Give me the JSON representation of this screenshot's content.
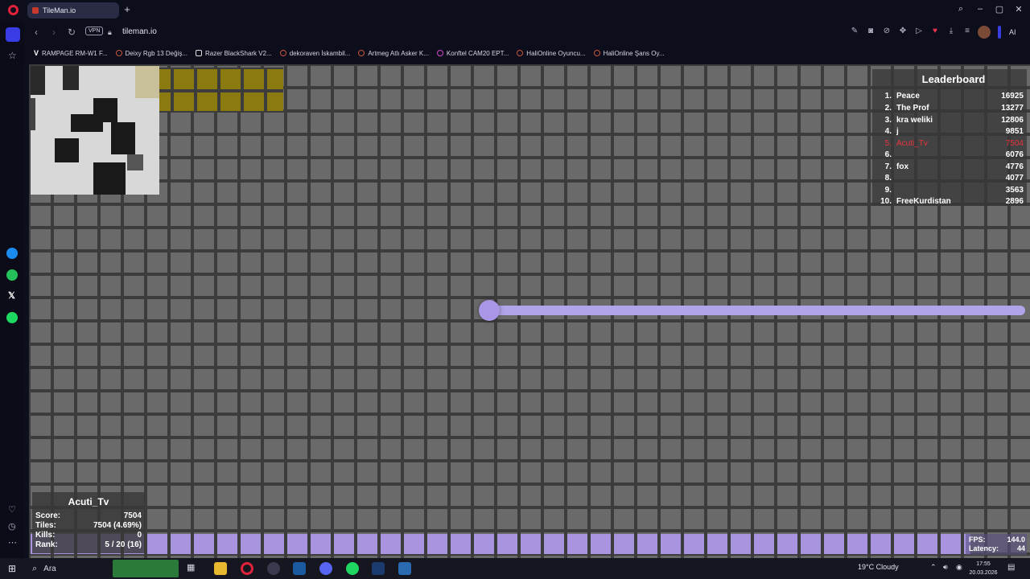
{
  "browser": {
    "tab_title": "TileMan.io",
    "url": "tileman.io",
    "vpn_label": "VPN",
    "ai_label": "AI",
    "bookmarks": [
      "RAMPAGE RM-W1 F...",
      "Deixy Rgb 13 Değiş...",
      "Razer BlackShark V2...",
      "dekoraven İskambil...",
      "Artmeg Atlı Asker K...",
      "Konftel CAM20 EPT...",
      "HaliOnline Oyuncu...",
      "HaliOnline Şans Oy..."
    ]
  },
  "leaderboard": {
    "title": "Leaderboard",
    "rows": [
      {
        "rank": "1.",
        "name": "Peace",
        "score": "16925"
      },
      {
        "rank": "2.",
        "name": "The Prof",
        "score": "13277"
      },
      {
        "rank": "3.",
        "name": "kra weliki",
        "score": "12806"
      },
      {
        "rank": "4.",
        "name": "j",
        "score": "9851"
      },
      {
        "rank": "5.",
        "name": "Acuti_Tv",
        "score": "7504"
      },
      {
        "rank": "6.",
        "name": "",
        "score": "6076"
      },
      {
        "rank": "7.",
        "name": "fox",
        "score": "4776"
      },
      {
        "rank": "8.",
        "name": "",
        "score": "4077"
      },
      {
        "rank": "9.",
        "name": "",
        "score": "3563"
      },
      {
        "rank": "10.",
        "name": "FreeKurdistan",
        "score": "2896"
      }
    ],
    "highlight_color": "#e8343c"
  },
  "player": {
    "name": "Acuti_Tv",
    "score_label": "Score:",
    "score": "7504",
    "tiles_label": "Tiles:",
    "tiles": "7504 (4.69%)",
    "kills_label": "Kills:",
    "kills": "0",
    "rank_label": "Rank:",
    "rank": "5 / 20 (16)",
    "color": "#a996e6"
  },
  "perf": {
    "fps_label": "FPS:",
    "fps": "144.0",
    "latency_label": "Latency:",
    "latency": "44"
  },
  "taskbar": {
    "search_label": "Ara",
    "weather": "19°C  Cloudy",
    "time": "17:55",
    "date": "20.03.2026"
  },
  "colors": {
    "territory_yellow": "#8a7a10",
    "tile_gray": "#6a6a6a",
    "grid_line": "#3c3c3c"
  }
}
